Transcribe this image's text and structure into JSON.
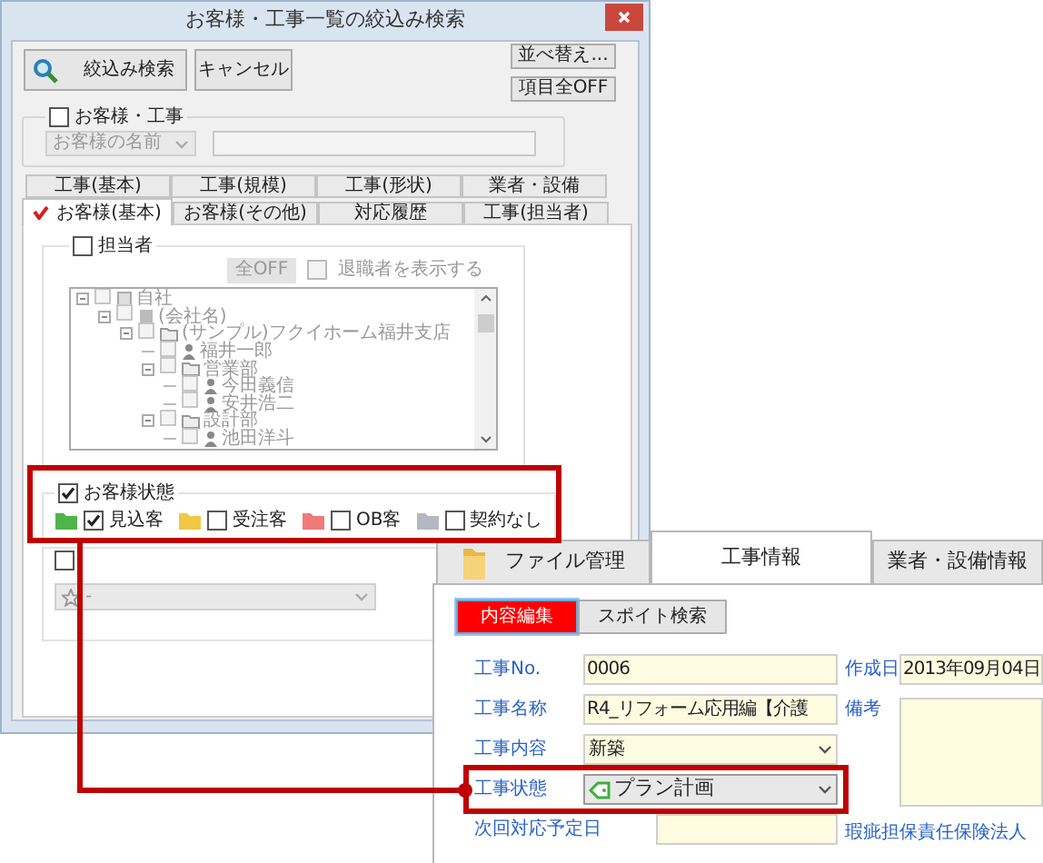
{
  "dialog": {
    "title": "お客様・工事一覧の絞込み検索",
    "buttons": [
      {
        "label": "絞込み検索",
        "kind": "search"
      },
      {
        "label": "キャンセル",
        "kind": "plain"
      }
    ],
    "side_buttons": [
      "並べ替え...",
      "項目全OFF"
    ],
    "customer_group": {
      "label": "お客様・工事",
      "checked": false,
      "dropdown": "お客様の名前"
    },
    "tabs_row_1": [
      {
        "label": "工事(基本)",
        "selected": false
      },
      {
        "label": "工事(規模)",
        "selected": false
      },
      {
        "label": "工事(形状)",
        "selected": false
      },
      {
        "label": "業者・設備",
        "selected": false
      }
    ],
    "tabs_row_2": [
      {
        "label": "お客様(基本)",
        "selected": true
      },
      {
        "label": "お客様(その他)",
        "selected": false
      },
      {
        "label": "対応履歴",
        "selected": false
      },
      {
        "label": "工事(担当者)",
        "selected": false
      }
    ],
    "staff_group": {
      "label": "担当者",
      "checked": false,
      "all_off_button": "全OFF",
      "show_retired": {
        "label": "退職者を表示する",
        "checked": false
      },
      "tree": [
        {
          "label": "自社",
          "kind": "root",
          "checked": false,
          "expanded": true,
          "children": [
            {
              "label": "(会社名)",
              "kind": "company",
              "checked": false,
              "expanded": true,
              "children": [
                {
                  "label": "(サンプル)フクイホーム福井支店",
                  "kind": "branch",
                  "checked": false,
                  "expanded": true,
                  "children": [
                    {
                      "label": "福井一郎",
                      "kind": "person",
                      "checked": false
                    },
                    {
                      "label": "営業部",
                      "kind": "branch",
                      "checked": false,
                      "expanded": true,
                      "children": [
                        {
                          "label": "今田義信",
                          "kind": "person",
                          "checked": false
                        },
                        {
                          "label": "安井浩二",
                          "kind": "person",
                          "checked": false
                        }
                      ]
                    },
                    {
                      "label": "設計部",
                      "kind": "branch",
                      "checked": false,
                      "expanded": true,
                      "children": [
                        {
                          "label": "池田洋斗",
                          "kind": "person",
                          "checked": false
                        }
                      ]
                    }
                  ]
                }
              ]
            }
          ]
        }
      ]
    },
    "status_group": {
      "label": "お客様状態",
      "checked": true,
      "options": [
        {
          "label": "見込客",
          "checked": true,
          "color": "#4fb548"
        },
        {
          "label": "受注客",
          "checked": false,
          "color": "#f2c744"
        },
        {
          "label": "OB客",
          "checked": false,
          "color": "#ee7b78"
        },
        {
          "label": "契約なし",
          "checked": false,
          "color": "#b4b8c0"
        }
      ]
    },
    "rank_filter": {
      "checked": false,
      "value": "-"
    }
  },
  "detail_window": {
    "tabs": [
      {
        "label": "ファイル管理",
        "selected": false,
        "kind": "folder"
      },
      {
        "label": "工事情報",
        "selected": true,
        "kind": "plain"
      },
      {
        "label": "業者・設備情報",
        "selected": false,
        "kind": "plain"
      }
    ],
    "mode_buttons": [
      {
        "label": "内容編集",
        "selected": true
      },
      {
        "label": "スポイト検索",
        "selected": false
      }
    ],
    "left_fields": [
      {
        "label": "工事No.",
        "value": "0006",
        "kind": "text"
      },
      {
        "label": "工事名称",
        "value": "R4_リフォーム応用編【介護",
        "kind": "text"
      },
      {
        "label": "工事内容",
        "value": "新築",
        "kind": "select"
      },
      {
        "label": "工事状態",
        "value": "プラン計画",
        "kind": "status_select"
      },
      {
        "label": "次回対応予定日",
        "kind": "date"
      }
    ],
    "right_fields": [
      {
        "label": "作成日",
        "value": "2013年09月04日",
        "kind": "text"
      },
      {
        "label": "備考",
        "kind": "textarea"
      },
      {
        "label": "瑕疵担保責任保険法人",
        "kind": "label_only"
      }
    ]
  }
}
